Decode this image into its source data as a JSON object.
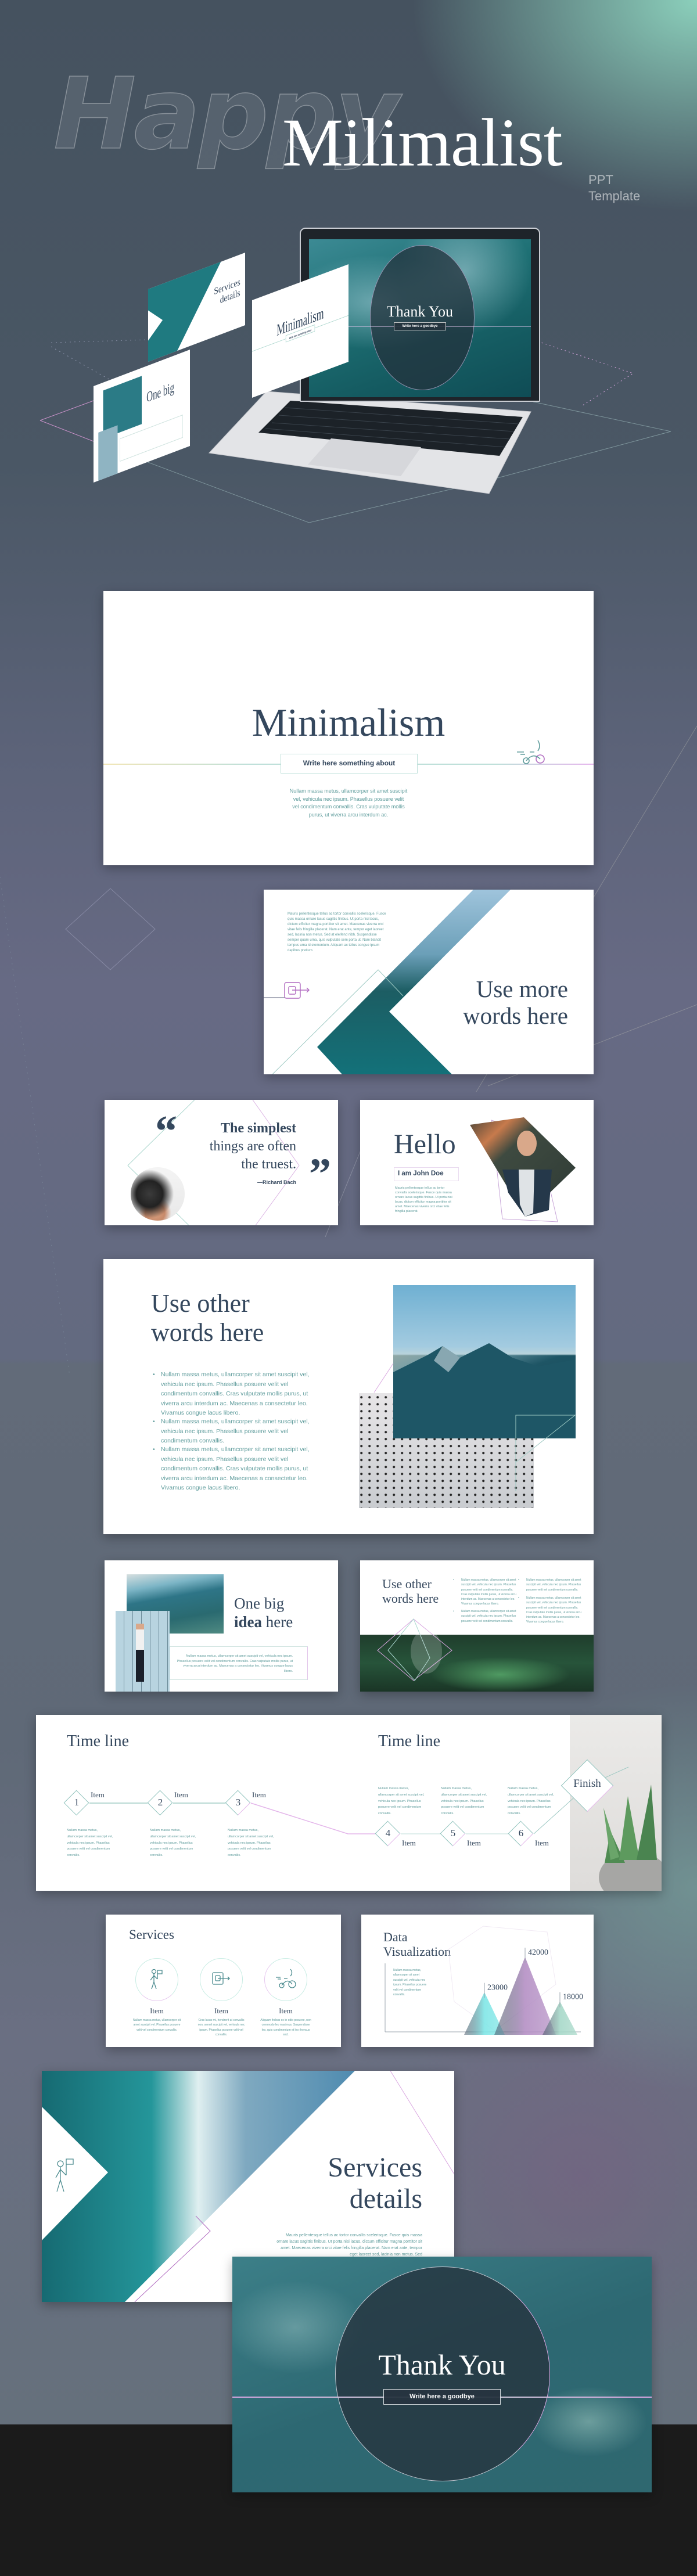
{
  "hero": {
    "ghost_word": "Happy",
    "title": "Milimalist",
    "subtitle_line1": "PPT",
    "subtitle_line2": "Template"
  },
  "slides": {
    "minimalism": {
      "title": "Minimalism",
      "tagline": "Write here something about",
      "body": "Nullam massa metus, ullamcorper sit amet suscipit vel, vehicula nec ipsum. Phasellus posuere velit vel condimentum convallis. Cras vulputate mollis purus, ut viverra arcu interdum ac.",
      "icon": "tricycle-icon"
    },
    "use_more": {
      "title_line1": "Use more",
      "title_line2": "words here",
      "body": "Mauris pellentesque tellus ac tortor convallis scelerisque. Fusce quis massa ornare lacus sagittis finibus. Ut porta nisi lacus, dictum efficitur magna porttitor sit amet. Maecenas viverra orci vitae felis fringilla placerat. Nam erat ante, tempor eget laoreet sed, lacinia non metus. Sed at eleifend nibh. Suspendisse semper quam urna, quis vulputate sem porta ut. Nam blandit tempus urna id elementum. Aliquam ac tellus congue ipsum dapibus pretium.",
      "icon": "spiral-arrow-icon"
    },
    "quote": {
      "line1": "The simplest",
      "line2": "things are often",
      "line3": "the truest.",
      "author": "—Richard Bach",
      "open_mark": "“",
      "close_mark": "”"
    },
    "hello": {
      "title": "Hello",
      "name": "I am John Doe",
      "body": "Mauris pellentesque tellus ac tortor convallis scelerisque. Fusce quis massa ornare lacus sagittis finibus. Ut porta nisi lacus, dictum efficitur magna porttitor sit amet. Maecenas viverra orci vitae felis fringilla placerat."
    },
    "use_other": {
      "title_line1": "Use other",
      "title_line2": "words here",
      "bullets": [
        "Nullam massa metus, ullamcorper sit amet suscipit vel, vehicula nec ipsum. Phasellus posuere velit vel condimentum convallis. Cras vulputate mollis purus, ut viverra arcu interdum ac. Maecenas a consectetur leo. Vivamus congue lacus libero.",
        "Nullam massa metus, ullamcorper sit amet suscipit vel, vehicula nec ipsum. Phasellus posuere velit vel condimentum convallis.",
        "Nullam massa metus, ullamcorper sit amet suscipit vel, vehicula nec ipsum. Phasellus posuere velit vel condimentum convallis. Cras vulputate mollis purus, ut viverra arcu interdum ac. Maecenas a consectetur leo. Vivamus congue lacus libero."
      ]
    },
    "big_idea": {
      "title_line1": "One big",
      "title_bold": "idea",
      "title_rest": " here",
      "body": "Nullam massa metus, ullamcorper sit amet suscipit vel, vehicula nec ipsum. Phasellus posuere velit vel condimentum convallis. Cras vulputate mollis purus, ut viverra arcu interdum ac. Maecenas a consectetur leo. Vivamus congue lacus libero."
    },
    "use_other_2": {
      "title_line1": "Use other",
      "title_line2": "words here",
      "col1": [
        "Nullam massa metus, ullamcorper sit amet suscipit vel, vehicula nec ipsum. Phasellus posuere velit vel condimentum convallis. Cras vulputate mollis purus, ut viverra arcu interdum ac. Maecenas a consectetur leo. Vivamus congue lacus libero.",
        "Nullam massa metus, ullamcorper sit amet suscipit vel, vehicula nec ipsum. Phasellus posuere velit vel condimentum convallis."
      ],
      "col2": [
        "Nullam massa metus, ullamcorper sit amet suscipit vel, vehicula nec ipsum. Phasellus posuere velit vel condimentum convallis.",
        "Nullam massa metus, ullamcorper sit amet suscipit vel, vehicula nec ipsum. Phasellus posuere velit vel condimentum convallis. Cras vulputate mollis purus, ut viverra arcu interdum ac. Maecenas a consectetur leo. Vivamus congue lacus libero."
      ]
    },
    "timeline": {
      "title_left": "Time line",
      "title_right": "Time line",
      "finish": "Finish",
      "steps": [
        {
          "num": "1",
          "label": "Item",
          "text": "Nullam massa metus, ullamcorper sit amet suscipit vel, vehicula nec ipsum. Phasellus posuere velit vel condimentum convallis."
        },
        {
          "num": "2",
          "label": "Item",
          "text": "Nullam massa metus, ullamcorper sit amet suscipit vel, vehicula nec ipsum. Phasellus posuere velit vel condimentum convallis."
        },
        {
          "num": "3",
          "label": "Item",
          "text": "Nullam massa metus, ullamcorper sit amet suscipit vel, vehicula nec ipsum. Phasellus posuere velit vel condimentum convallis."
        },
        {
          "num": "4",
          "label": "Item",
          "text": "Nullam massa metus, ullamcorper sit amet suscipit vel, vehicula nec ipsum. Phasellus posuere velit vel condimentum convallis."
        },
        {
          "num": "5",
          "label": "Item",
          "text": "Nullam massa metus, ullamcorper sit amet suscipit vel, vehicula nec ipsum. Phasellus posuere velit vel condimentum convallis."
        },
        {
          "num": "6",
          "label": "Item",
          "text": "Nullam massa metus, ullamcorper sit amet suscipit vel, vehicula nec ipsum. Phasellus posuere velit vel condimentum convallis."
        }
      ]
    },
    "services": {
      "title": "Services",
      "items": [
        {
          "icon": "walking-man-flag-icon",
          "label": "Item",
          "text": "Nullam massa metus, ullamcorper sit amet suscipit vel. Phasellus posuere velit vel condimentum convallis."
        },
        {
          "icon": "spiral-arrow-icon",
          "label": "Item",
          "text": "Cras lacus mi, hendrerit at convallis non, semel suscipit vel, vehicula nec ipsum. Phasellus posuere velit vel convallis."
        },
        {
          "icon": "tricycle-icon",
          "label": "Item",
          "text": "Aliquam finibus ex in odio posuere, non commodo leo maximus. Suspendisse leo, quis condimentum et leo rhoncus sed."
        }
      ]
    },
    "data_viz": {
      "title_line1": "Data",
      "title_line2": "Visualization",
      "body": "Nullam massa metus, ullamcorper sit amet suscipit vel, vehicula nec ipsum. Phasellus posuere velit vel condimentum convallis.",
      "values": [
        23000,
        42000,
        18000
      ],
      "labels": [
        "23000",
        "42000",
        "18000"
      ],
      "colors": [
        "#7fe6e6",
        "#b48fc4",
        "#a6d8c8"
      ]
    },
    "services_details": {
      "title_line1": "Services",
      "title_line2": "details",
      "body": "Mauris pellentesque tellus ac tortor convallis scelerisque. Fusce quis massa ornare lacus sagittis finibus. Ut porta nisi lacus, dictum efficitur magna porttitor sit amet. Maecenas viverra orci vitae felis fringilla placerat. Nam erat ante, tempor eget laoreet sed, lacinia non metus. Sed",
      "icon": "walking-man-flag-icon"
    },
    "thank_you": {
      "title": "Thank You",
      "tagline": "Write here a goodbye"
    }
  },
  "colors": {
    "title": "#34475d",
    "body_text": "#5f9c9c",
    "accent_pink": "#d9a6e0",
    "accent_teal": "#a8d5cc",
    "hero_mint": "#8fd6c0",
    "footer": "#1b1b1b"
  }
}
